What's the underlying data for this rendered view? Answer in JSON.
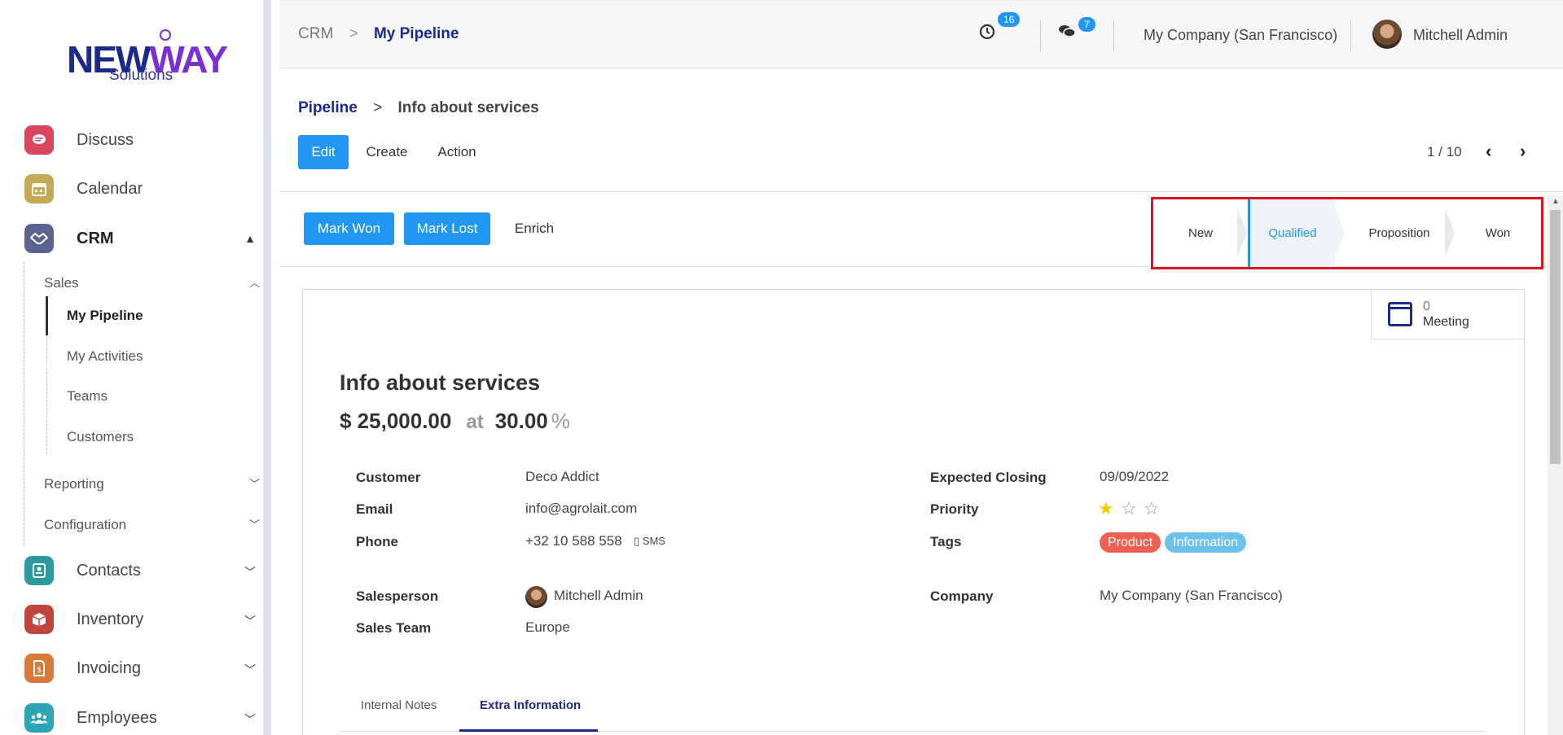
{
  "logo": {
    "brand_a": "NEW",
    "brand_b": "WAY",
    "sub": "Solutions"
  },
  "sidebar": {
    "apps": [
      {
        "label": "Discuss",
        "color": "#d9455f"
      },
      {
        "label": "Calendar",
        "color": "#c6a953"
      },
      {
        "label": "CRM",
        "color": "#5c6390"
      },
      {
        "label": "Contacts",
        "color": "#2b9aa0"
      },
      {
        "label": "Inventory",
        "color": "#c2453d"
      },
      {
        "label": "Invoicing",
        "color": "#d97a3a"
      },
      {
        "label": "Employees",
        "color": "#2ea5b5"
      }
    ],
    "crm_sections": {
      "sales": "Sales",
      "reporting": "Reporting",
      "configuration": "Configuration"
    },
    "sales_items": [
      "My Pipeline",
      "My Activities",
      "Teams",
      "Customers"
    ]
  },
  "topbar": {
    "crumb_root": "CRM",
    "crumb_sep": ">",
    "crumb_current": "My Pipeline",
    "activity_count": "16",
    "message_count": "7",
    "company": "My Company (San Francisco)",
    "user": "Mitchell Admin"
  },
  "control_panel": {
    "crumb_parent": "Pipeline",
    "crumb_sep": ">",
    "crumb_current": "Info about services",
    "edit": "Edit",
    "create": "Create",
    "action": "Action",
    "pager": "1 / 10"
  },
  "statusbar": {
    "mark_won": "Mark Won",
    "mark_lost": "Mark Lost",
    "enrich": "Enrich",
    "stages": [
      "New",
      "Qualified",
      "Proposition",
      "Won"
    ],
    "current_stage": "Qualified"
  },
  "smart_button": {
    "count": "0",
    "label": "Meeting"
  },
  "record": {
    "title": "Info about services",
    "revenue": "$ 25,000.00",
    "at": "at",
    "probability": "30.00",
    "percent": "%",
    "fields_left": {
      "customer_label": "Customer",
      "customer": "Deco Addict",
      "email_label": "Email",
      "email": "info@agrolait.com",
      "phone_label": "Phone",
      "phone": "+32 10 588 558",
      "sms": "SMS",
      "salesperson_label": "Salesperson",
      "salesperson": "Mitchell Admin",
      "team_label": "Sales Team",
      "team": "Europe"
    },
    "fields_right": {
      "closing_label": "Expected Closing",
      "closing": "09/09/2022",
      "priority_label": "Priority",
      "priority_stars": 1,
      "priority_max": 3,
      "tags_label": "Tags",
      "tags": [
        {
          "label": "Product",
          "color": "#f06050"
        },
        {
          "label": "Information",
          "color": "#6cc1ed"
        }
      ],
      "company_label": "Company",
      "company": "My Company (San Francisco)"
    },
    "tabs": [
      "Internal Notes",
      "Extra Information"
    ],
    "active_tab": "Extra Information"
  }
}
